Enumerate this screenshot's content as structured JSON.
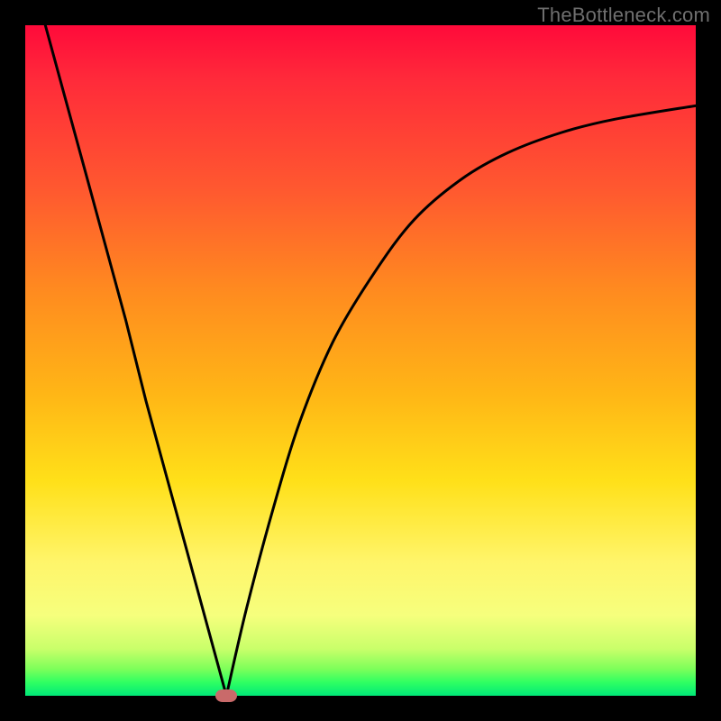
{
  "watermark": "TheBottleneck.com",
  "colors": {
    "frame": "#000000",
    "curve": "#000000",
    "marker": "#c96a6a",
    "gradient_top": "#ff0a3a",
    "gradient_bottom": "#00e878"
  },
  "chart_data": {
    "type": "line",
    "title": "",
    "xlabel": "",
    "ylabel": "",
    "xlim": [
      0,
      100
    ],
    "ylim": [
      0,
      100
    ],
    "grid": false,
    "legend": false,
    "series": [
      {
        "name": "left-branch",
        "x": [
          3,
          6,
          9,
          12,
          15,
          18,
          21,
          24,
          27,
          30
        ],
        "values": [
          100,
          89,
          78,
          67,
          56,
          44,
          33,
          22,
          11,
          0
        ]
      },
      {
        "name": "right-branch",
        "x": [
          30,
          33,
          37,
          41,
          46,
          52,
          58,
          65,
          72,
          80,
          88,
          100
        ],
        "values": [
          0,
          13,
          28,
          41,
          53,
          63,
          71,
          77,
          81,
          84,
          86,
          88
        ]
      }
    ],
    "annotations": [
      {
        "name": "min-marker",
        "x": 30,
        "y": 0
      }
    ]
  }
}
